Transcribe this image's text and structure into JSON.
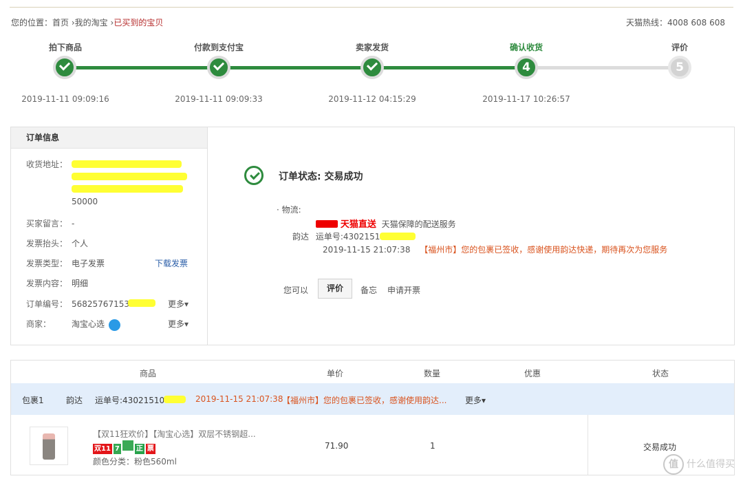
{
  "breadcrumb": {
    "prefix": "您的位置：",
    "home": "首页",
    "sep": "›",
    "mytaobao": "我的淘宝",
    "current": "已买到的宝贝"
  },
  "hotline": "天猫热线：4008 608 608",
  "steps": [
    {
      "label": "拍下商品",
      "time": "2019-11-11 09:09:16",
      "state": "done"
    },
    {
      "label": "付款到支付宝",
      "time": "2019-11-11 09:09:33",
      "state": "done"
    },
    {
      "label": "卖家发货",
      "time": "2019-11-12 04:15:29",
      "state": "done"
    },
    {
      "label": "确认收货",
      "time": "2019-11-17 10:26:57",
      "state": "current",
      "num": "4"
    },
    {
      "label": "评价",
      "time": "",
      "state": "todo",
      "num": "5"
    }
  ],
  "order_info": {
    "title": "订单信息",
    "address_label": "收货地址：",
    "address_tail": "50000",
    "buyer_msg_label": "买家留言：",
    "buyer_msg": "-",
    "invoice_title_label": "发票抬头：",
    "invoice_title": "个人",
    "invoice_type_label": "发票类型：",
    "invoice_type": "电子发票",
    "download_invoice": "下载发票",
    "invoice_content_label": "发票内容：",
    "invoice_content": "明细",
    "order_no_label": "订单编号：",
    "order_no": "568257671539",
    "merchant_label": "商家：",
    "merchant": "淘宝心选",
    "more": "更多▾"
  },
  "status": {
    "text": "订单状态: 交易成功",
    "logistics_label": "· 物流:",
    "tmall_direct": "天猫直送",
    "tmall_desc": "天猫保障的配送服务",
    "carrier": "韵达",
    "waybill_label": "运单号:",
    "waybill": "4302151",
    "track_time": "2019-11-15 21:07:38",
    "track_msg": "【福州市】您的包裹已签收，感谢使用韵达快递，期待再次为您服务",
    "you_can": "您可以",
    "review_btn": "评价",
    "memo": "备忘",
    "apply_invoice": "申请开票"
  },
  "table": {
    "headers": [
      "商品",
      "单价",
      "数量",
      "优惠",
      "状态"
    ],
    "package": {
      "name": "包裹1",
      "carrier": "韵达",
      "waybill": "运单号:430215104",
      "time": "2019-11-15 21:07:38",
      "msg": "【福州市】您的包裹已签收，感谢使用韵达...",
      "more": "更多▾"
    },
    "item": {
      "title": "【双11狂欢价】【淘宝心选】双层不锈钢超...",
      "tags": [
        "双11",
        "7",
        "",
        "正",
        "票"
      ],
      "spec": "颜色分类：粉色560ml",
      "price": "71.90",
      "qty": "1",
      "status": "交易成功"
    }
  },
  "watermark": {
    "glyph": "值",
    "text": "什么值得买"
  }
}
